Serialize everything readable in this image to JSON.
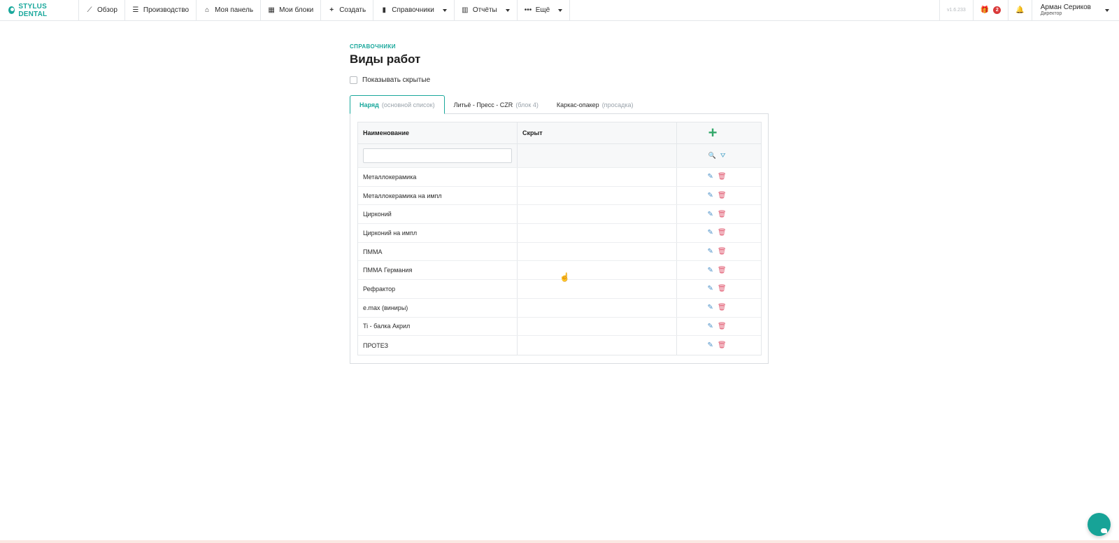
{
  "brand": {
    "name": "STYLUS DENTAL"
  },
  "nav": {
    "items": [
      {
        "icon": "chart-line-icon",
        "label": "Обзор",
        "caret": false
      },
      {
        "icon": "list-icon",
        "label": "Производство",
        "caret": false
      },
      {
        "icon": "home-icon",
        "label": "Моя панель",
        "caret": false
      },
      {
        "icon": "grid-icon",
        "label": "Мои блоки",
        "caret": false
      },
      {
        "icon": "plus-icon",
        "label": "Создать",
        "caret": false
      },
      {
        "icon": "book-icon",
        "label": "Справочники",
        "caret": true
      },
      {
        "icon": "bar-chart-icon",
        "label": "Отчёты",
        "caret": true
      },
      {
        "icon": "ellipsis-icon",
        "label": "Ещё",
        "caret": true
      }
    ],
    "version": "v1.6.233",
    "gift_badge": "2",
    "user": {
      "name": "Арман Сериков",
      "role": "Директор"
    }
  },
  "page": {
    "breadcrumb": "СПРАВОЧНИКИ",
    "title": "Виды работ",
    "show_hidden_label": "Показывать скрытые"
  },
  "tabs": [
    {
      "label": "Наряд",
      "sub": "(основной список)",
      "active": true
    },
    {
      "label": "Литьё - Пресс - CZR",
      "sub": "(блок 4)",
      "active": false
    },
    {
      "label": "Каркас-опакер",
      "sub": "(просадка)",
      "active": false
    }
  ],
  "table": {
    "columns": [
      "Наименование",
      "Скрыт"
    ],
    "rows": [
      "Металлокерамика",
      "Металлокерамика на импл",
      "Цирконий",
      "Цирконий на импл",
      "ПММА",
      "ПММА Германия",
      "Рефрактор",
      "e.max (виниры)",
      "Ti - балка Акрил",
      "ПРОТЕЗ"
    ]
  },
  "colors": {
    "accent": "#1aa89c",
    "add": "#34a86a",
    "edit": "#4a90c8",
    "delete": "#e0566d",
    "badge": "#d93939"
  }
}
